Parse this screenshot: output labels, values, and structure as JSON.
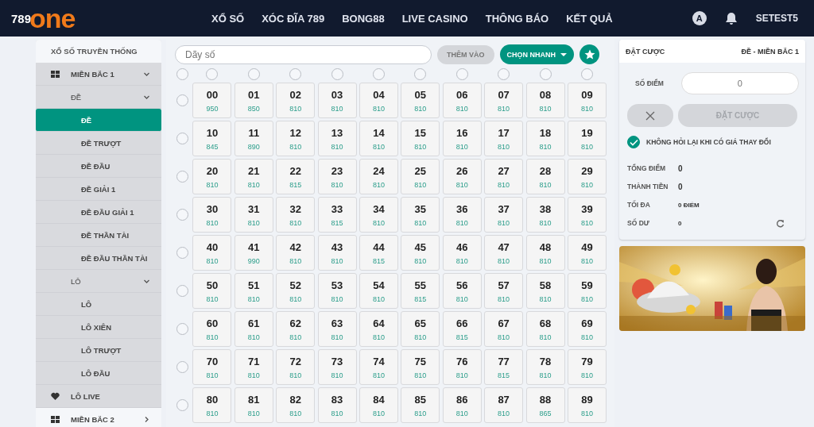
{
  "header": {
    "logo": {
      "prefix": "789",
      "name": "one"
    },
    "nav": [
      "XỔ SỐ",
      "XÓC ĐĨA 789",
      "BONG88",
      "LIVE CASINO",
      "THÔNG BÁO",
      "KẾT QUẢ"
    ],
    "avatar_letter": "A",
    "username": "SETEST5"
  },
  "sidebar": {
    "title": "XỔ SỐ TRUYỀN THỐNG",
    "items": [
      {
        "label": "MIỀN BẮC 1",
        "kind": "region",
        "expanded": true,
        "children": [
          {
            "label": "ĐỀ",
            "kind": "group",
            "expanded": true,
            "children": [
              {
                "label": "ĐỀ",
                "selected": true
              },
              {
                "label": "ĐỀ TRƯỢT",
                "selected": false
              },
              {
                "label": "ĐỀ ĐẦU",
                "selected": false
              },
              {
                "label": "ĐỀ GIẢI 1",
                "selected": false
              },
              {
                "label": "ĐỀ ĐẦU GIẢI 1",
                "selected": false
              },
              {
                "label": "ĐỀ THẦN TÀI",
                "selected": false
              },
              {
                "label": "ĐỀ ĐẦU THẦN TÀI",
                "selected": false
              }
            ]
          },
          {
            "label": "LÔ",
            "kind": "group",
            "expanded": true,
            "children": [
              {
                "label": "LÔ",
                "selected": false
              },
              {
                "label": "LÔ XIÊN",
                "selected": false
              },
              {
                "label": "LÔ TRƯỢT",
                "selected": false
              },
              {
                "label": "LÔ ĐẦU",
                "selected": false
              }
            ]
          },
          {
            "label": "LÔ LIVE",
            "kind": "live",
            "selected": false
          }
        ]
      },
      {
        "label": "MIỀN BẮC 2",
        "kind": "region",
        "expanded": false
      }
    ]
  },
  "picker": {
    "search": {
      "placeholder": "Dãy số"
    },
    "add_button": {
      "label": "THÊM VÀO",
      "disabled": true
    },
    "quick_button": "CHỌN NHANH",
    "all_checked": false,
    "columns": [
      {
        "checked": false
      },
      {
        "checked": false
      },
      {
        "checked": false
      },
      {
        "checked": false
      },
      {
        "checked": false
      },
      {
        "checked": false
      },
      {
        "checked": false
      },
      {
        "checked": false
      },
      {
        "checked": false
      },
      {
        "checked": false
      }
    ],
    "rows": [
      {
        "checked": false,
        "cells": [
          [
            "00",
            "950"
          ],
          [
            "01",
            "850"
          ],
          [
            "02",
            "810"
          ],
          [
            "03",
            "810"
          ],
          [
            "04",
            "810"
          ],
          [
            "05",
            "810"
          ],
          [
            "06",
            "810"
          ],
          [
            "07",
            "810"
          ],
          [
            "08",
            "810"
          ],
          [
            "09",
            "810"
          ]
        ]
      },
      {
        "checked": false,
        "cells": [
          [
            "10",
            "845"
          ],
          [
            "11",
            "890"
          ],
          [
            "12",
            "810"
          ],
          [
            "13",
            "810"
          ],
          [
            "14",
            "810"
          ],
          [
            "15",
            "810"
          ],
          [
            "16",
            "810"
          ],
          [
            "17",
            "810"
          ],
          [
            "18",
            "810"
          ],
          [
            "19",
            "810"
          ]
        ]
      },
      {
        "checked": false,
        "cells": [
          [
            "20",
            "810"
          ],
          [
            "21",
            "810"
          ],
          [
            "22",
            "815"
          ],
          [
            "23",
            "810"
          ],
          [
            "24",
            "810"
          ],
          [
            "25",
            "810"
          ],
          [
            "26",
            "810"
          ],
          [
            "27",
            "810"
          ],
          [
            "28",
            "810"
          ],
          [
            "29",
            "810"
          ]
        ]
      },
      {
        "checked": false,
        "cells": [
          [
            "30",
            "810"
          ],
          [
            "31",
            "810"
          ],
          [
            "32",
            "810"
          ],
          [
            "33",
            "815"
          ],
          [
            "34",
            "810"
          ],
          [
            "35",
            "810"
          ],
          [
            "36",
            "810"
          ],
          [
            "37",
            "810"
          ],
          [
            "38",
            "810"
          ],
          [
            "39",
            "810"
          ]
        ]
      },
      {
        "checked": false,
        "cells": [
          [
            "40",
            "810"
          ],
          [
            "41",
            "990"
          ],
          [
            "42",
            "810"
          ],
          [
            "43",
            "810"
          ],
          [
            "44",
            "815"
          ],
          [
            "45",
            "810"
          ],
          [
            "46",
            "810"
          ],
          [
            "47",
            "810"
          ],
          [
            "48",
            "810"
          ],
          [
            "49",
            "810"
          ]
        ]
      },
      {
        "checked": false,
        "cells": [
          [
            "50",
            "810"
          ],
          [
            "51",
            "810"
          ],
          [
            "52",
            "810"
          ],
          [
            "53",
            "810"
          ],
          [
            "54",
            "810"
          ],
          [
            "55",
            "815"
          ],
          [
            "56",
            "810"
          ],
          [
            "57",
            "810"
          ],
          [
            "58",
            "810"
          ],
          [
            "59",
            "810"
          ]
        ]
      },
      {
        "checked": false,
        "cells": [
          [
            "60",
            "810"
          ],
          [
            "61",
            "810"
          ],
          [
            "62",
            "810"
          ],
          [
            "63",
            "810"
          ],
          [
            "64",
            "810"
          ],
          [
            "65",
            "810"
          ],
          [
            "66",
            "815"
          ],
          [
            "67",
            "810"
          ],
          [
            "68",
            "810"
          ],
          [
            "69",
            "810"
          ]
        ]
      },
      {
        "checked": false,
        "cells": [
          [
            "70",
            "810"
          ],
          [
            "71",
            "810"
          ],
          [
            "72",
            "810"
          ],
          [
            "73",
            "810"
          ],
          [
            "74",
            "810"
          ],
          [
            "75",
            "810"
          ],
          [
            "76",
            "810"
          ],
          [
            "77",
            "815"
          ],
          [
            "78",
            "810"
          ],
          [
            "79",
            "810"
          ]
        ]
      },
      {
        "checked": false,
        "cells": [
          [
            "80",
            "810"
          ],
          [
            "81",
            "810"
          ],
          [
            "82",
            "810"
          ],
          [
            "83",
            "810"
          ],
          [
            "84",
            "810"
          ],
          [
            "85",
            "810"
          ],
          [
            "86",
            "810"
          ],
          [
            "87",
            "810"
          ],
          [
            "88",
            "865"
          ],
          [
            "89",
            "810"
          ]
        ]
      }
    ]
  },
  "bet": {
    "title": "ĐẶT CƯỢC",
    "subtitle": "ĐỀ - MIỀN BẮC 1",
    "score_label": "SỐ ĐIỂM",
    "score_placeholder": "0",
    "submit": {
      "label": "ĐẶT CƯỢC",
      "disabled": true
    },
    "confirm": {
      "label": "KHÔNG HỎI LẠI KHI CÓ GIÁ THAY ĐỔI",
      "checked": true
    },
    "summary": [
      {
        "label": "TỔNG ĐIỂM",
        "value": "0",
        "kind": "big"
      },
      {
        "label": "THÀNH TIỀN",
        "value": "0",
        "kind": "big"
      },
      {
        "label": "TỐI ĐA",
        "value": "0 ĐIỂM",
        "kind": "small"
      },
      {
        "label": "SỐ DƯ",
        "value": "0",
        "kind": "refresh"
      }
    ]
  }
}
